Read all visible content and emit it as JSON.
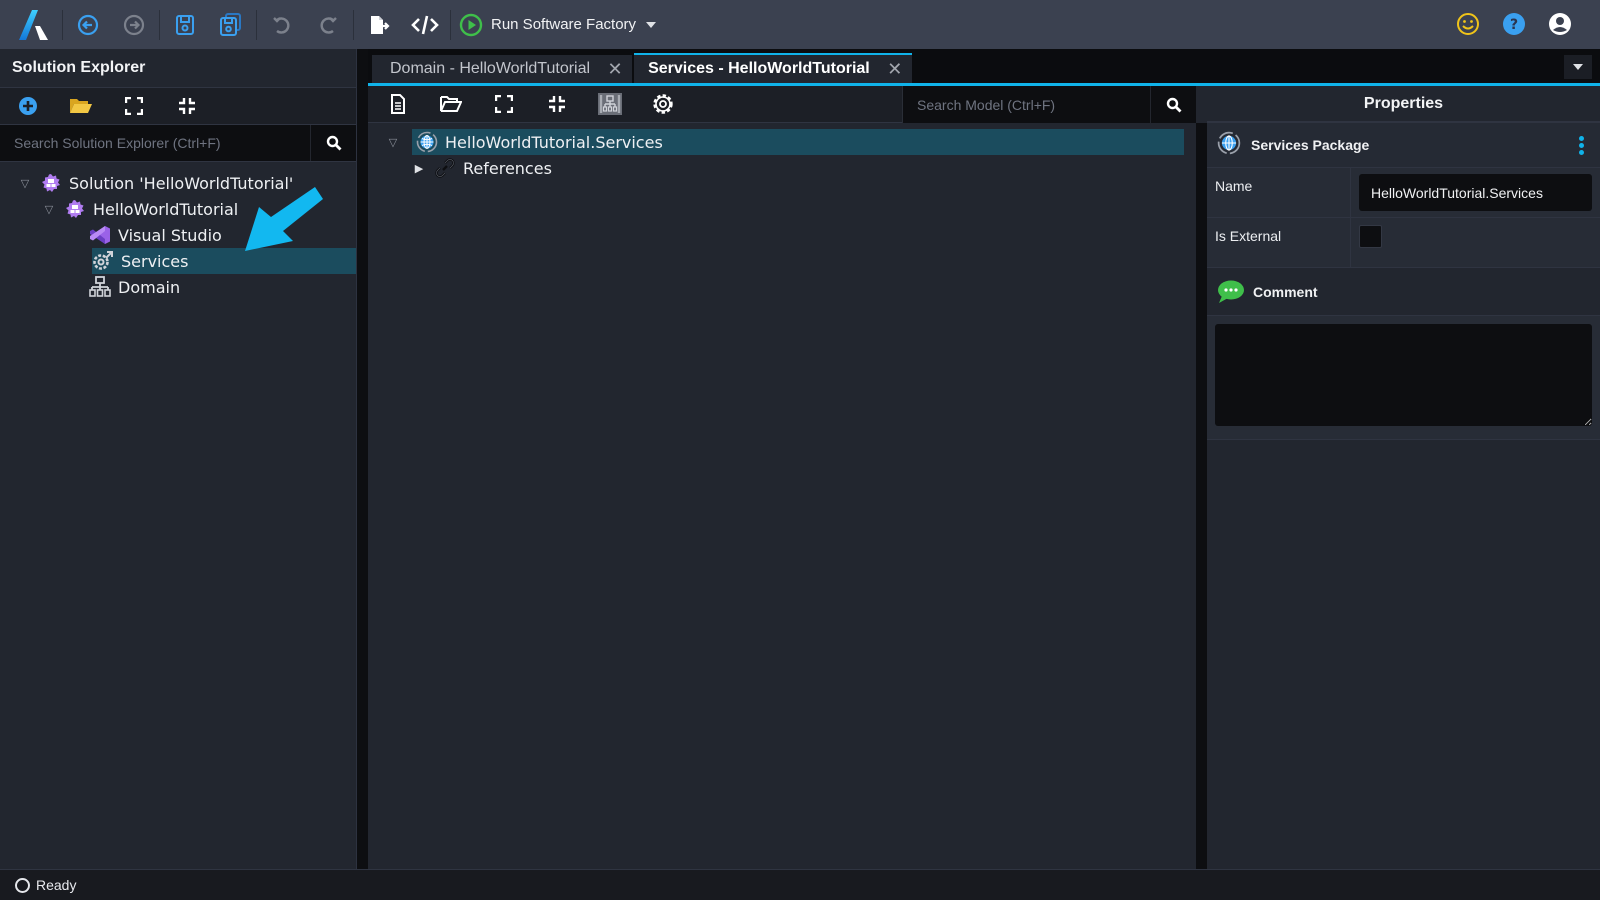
{
  "colors": {
    "accent": "#10b3ea",
    "selection": "#1b4c5e",
    "toolbar_bg": "#3b4150",
    "panel_bg": "#22262f",
    "run_green": "#3fbf4a",
    "smiley_yellow": "#f0c419",
    "help_blue": "#3aa0f0",
    "purple": "#b07cf0"
  },
  "toolbar": {
    "logo_icon": "intent-architect-logo",
    "buttons": [
      {
        "name": "back",
        "icon": "arrow-left-circle-icon"
      },
      {
        "name": "forward",
        "icon": "arrow-right-circle-icon"
      },
      {
        "name": "save",
        "icon": "save-icon"
      },
      {
        "name": "save-all",
        "icon": "save-all-icon"
      },
      {
        "name": "undo",
        "icon": "undo-icon"
      },
      {
        "name": "redo",
        "icon": "redo-icon"
      },
      {
        "name": "export",
        "icon": "file-export-icon"
      },
      {
        "name": "code",
        "icon": "code-icon"
      }
    ],
    "run_label": "Run Software Factory",
    "right_icons": [
      "smiley-icon",
      "help-icon",
      "user-account-icon"
    ]
  },
  "solution_explorer": {
    "title": "Solution Explorer",
    "tools": [
      "add-icon",
      "open-folder-icon",
      "expand-all-icon",
      "collapse-all-icon"
    ],
    "search_placeholder": "Search Solution Explorer (Ctrl+F)",
    "tree": [
      {
        "label": "Solution 'HelloWorldTutorial'",
        "icon": "solution-icon",
        "level": 0,
        "expanded": true
      },
      {
        "label": "HelloWorldTutorial",
        "icon": "application-icon",
        "level": 1,
        "expanded": true
      },
      {
        "label": "Visual Studio",
        "icon": "visual-studio-icon",
        "level": 2
      },
      {
        "label": "Services",
        "icon": "services-icon",
        "level": 2,
        "selected": true
      },
      {
        "label": "Domain",
        "icon": "domain-icon",
        "level": 2
      }
    ]
  },
  "tabs": [
    {
      "label": "Domain - HelloWorldTutorial",
      "active": false
    },
    {
      "label": "Services - HelloWorldTutorial",
      "active": true
    }
  ],
  "model": {
    "tools": [
      "new-file-icon",
      "open-folder-icon",
      "expand-all-icon",
      "collapse-all-icon",
      "diagram-icon",
      "settings-icon"
    ],
    "search_placeholder": "Search Model (Ctrl+F)",
    "tree": [
      {
        "label": "HelloWorldTutorial.Services",
        "icon": "services-package-icon",
        "expanded": true,
        "selected": true
      },
      {
        "label": "References",
        "icon": "link-icon",
        "expanded": false
      }
    ]
  },
  "properties": {
    "title": "Properties",
    "section_title": "Services Package",
    "fields": [
      {
        "label": "Name",
        "type": "text",
        "value": "HelloWorldTutorial.Services"
      },
      {
        "label": "Is External",
        "type": "checkbox",
        "checked": false
      }
    ],
    "comment_title": "Comment",
    "comment_value": ""
  },
  "status": {
    "text": "Ready"
  }
}
